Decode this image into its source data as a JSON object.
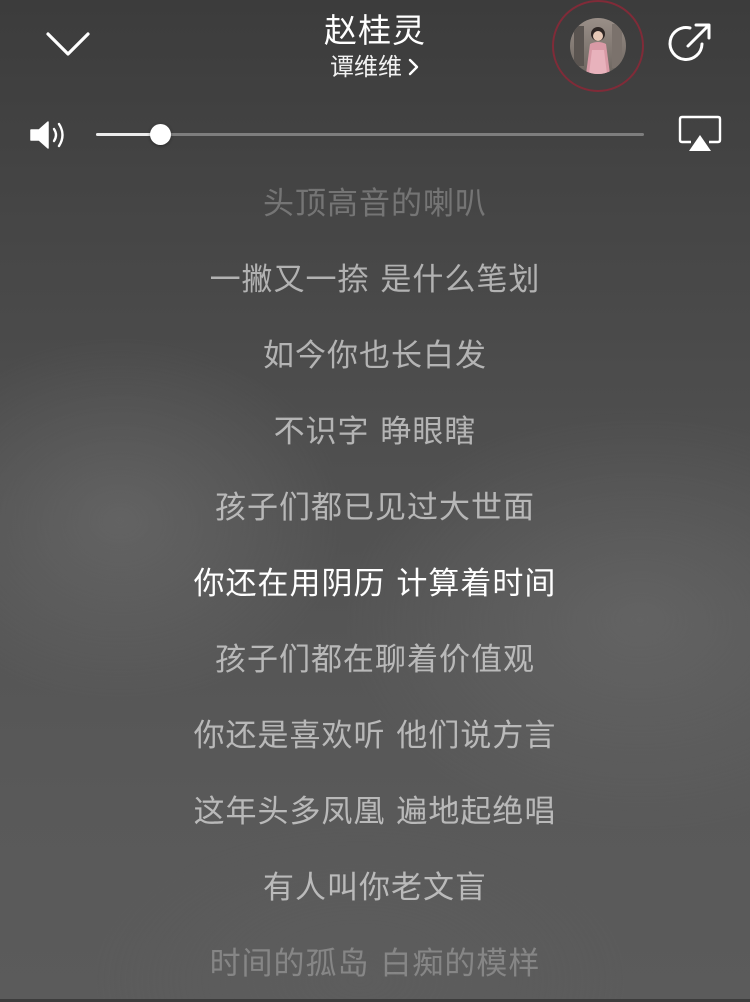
{
  "header": {
    "title": "赵桂灵",
    "artist": "谭维维",
    "icons": {
      "collapse": "chevron-down-icon",
      "artist_link": "chevron-right-icon",
      "share": "share-icon"
    }
  },
  "volume": {
    "level": 0.117,
    "icons": {
      "speaker": "speaker-icon",
      "airplay": "airplay-icon"
    }
  },
  "lyrics": {
    "active_index": 5,
    "lines": [
      "头顶高音的喇叭",
      "一撇又一捺 是什么笔划",
      "如今你也长白发",
      "不识字 睁眼瞎",
      "孩子们都已见过大世面",
      "你还在用阴历 计算着时间",
      "孩子们都在聊着价值观",
      "你还是喜欢听 他们说方言",
      "这年头多凤凰 遍地起绝唱",
      "有人叫你老文盲",
      "时间的孤岛 白痴的模样"
    ]
  },
  "colors": {
    "text_primary": "#ffffff",
    "text_secondary": "rgba(255,255,255,0.58)",
    "avatar_ring": "#8c2837"
  }
}
